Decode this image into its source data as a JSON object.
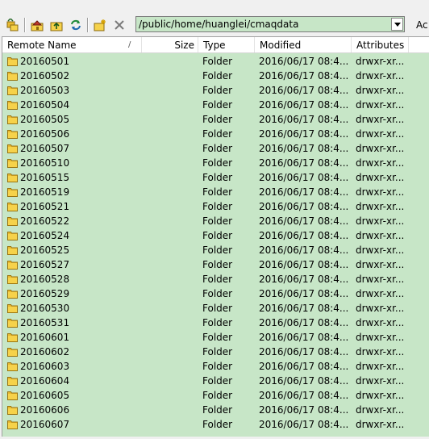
{
  "toolbar": {
    "path": "/public/home/huanglei/cmaqdata",
    "cut_label": "Ac",
    "icons": [
      "parent-dir-icon",
      "home-icon",
      "root-dir-icon",
      "refresh-icon",
      "new-folder-icon",
      "delete-icon"
    ]
  },
  "table": {
    "columns": {
      "name": "Remote Name",
      "sort_indicator": "/",
      "size": "Size",
      "type": "Type",
      "modified": "Modified",
      "attributes": "Attributes"
    },
    "rows": [
      {
        "name": "20160501",
        "type": "Folder",
        "modified": "2016/06/17 08:4...",
        "attributes": "drwxr-xr..."
      },
      {
        "name": "20160502",
        "type": "Folder",
        "modified": "2016/06/17 08:4...",
        "attributes": "drwxr-xr..."
      },
      {
        "name": "20160503",
        "type": "Folder",
        "modified": "2016/06/17 08:4...",
        "attributes": "drwxr-xr..."
      },
      {
        "name": "20160504",
        "type": "Folder",
        "modified": "2016/06/17 08:4...",
        "attributes": "drwxr-xr..."
      },
      {
        "name": "20160505",
        "type": "Folder",
        "modified": "2016/06/17 08:4...",
        "attributes": "drwxr-xr..."
      },
      {
        "name": "20160506",
        "type": "Folder",
        "modified": "2016/06/17 08:4...",
        "attributes": "drwxr-xr..."
      },
      {
        "name": "20160507",
        "type": "Folder",
        "modified": "2016/06/17 08:4...",
        "attributes": "drwxr-xr..."
      },
      {
        "name": "20160510",
        "type": "Folder",
        "modified": "2016/06/17 08:4...",
        "attributes": "drwxr-xr..."
      },
      {
        "name": "20160515",
        "type": "Folder",
        "modified": "2016/06/17 08:4...",
        "attributes": "drwxr-xr..."
      },
      {
        "name": "20160519",
        "type": "Folder",
        "modified": "2016/06/17 08:4...",
        "attributes": "drwxr-xr..."
      },
      {
        "name": "20160521",
        "type": "Folder",
        "modified": "2016/06/17 08:4...",
        "attributes": "drwxr-xr..."
      },
      {
        "name": "20160522",
        "type": "Folder",
        "modified": "2016/06/17 08:4...",
        "attributes": "drwxr-xr..."
      },
      {
        "name": "20160524",
        "type": "Folder",
        "modified": "2016/06/17 08:4...",
        "attributes": "drwxr-xr..."
      },
      {
        "name": "20160525",
        "type": "Folder",
        "modified": "2016/06/17 08:4...",
        "attributes": "drwxr-xr..."
      },
      {
        "name": "20160527",
        "type": "Folder",
        "modified": "2016/06/17 08:4...",
        "attributes": "drwxr-xr..."
      },
      {
        "name": "20160528",
        "type": "Folder",
        "modified": "2016/06/17 08:4...",
        "attributes": "drwxr-xr..."
      },
      {
        "name": "20160529",
        "type": "Folder",
        "modified": "2016/06/17 08:4...",
        "attributes": "drwxr-xr..."
      },
      {
        "name": "20160530",
        "type": "Folder",
        "modified": "2016/06/17 08:4...",
        "attributes": "drwxr-xr..."
      },
      {
        "name": "20160531",
        "type": "Folder",
        "modified": "2016/06/17 08:4...",
        "attributes": "drwxr-xr..."
      },
      {
        "name": "20160601",
        "type": "Folder",
        "modified": "2016/06/17 08:4...",
        "attributes": "drwxr-xr..."
      },
      {
        "name": "20160602",
        "type": "Folder",
        "modified": "2016/06/17 08:4...",
        "attributes": "drwxr-xr..."
      },
      {
        "name": "20160603",
        "type": "Folder",
        "modified": "2016/06/17 08:4...",
        "attributes": "drwxr-xr..."
      },
      {
        "name": "20160604",
        "type": "Folder",
        "modified": "2016/06/17 08:4...",
        "attributes": "drwxr-xr..."
      },
      {
        "name": "20160605",
        "type": "Folder",
        "modified": "2016/06/17 08:4...",
        "attributes": "drwxr-xr..."
      },
      {
        "name": "20160606",
        "type": "Folder",
        "modified": "2016/06/17 08:4...",
        "attributes": "drwxr-xr..."
      },
      {
        "name": "20160607",
        "type": "Folder",
        "modified": "2016/06/17 08:4...",
        "attributes": "drwxr-xr..."
      }
    ]
  }
}
